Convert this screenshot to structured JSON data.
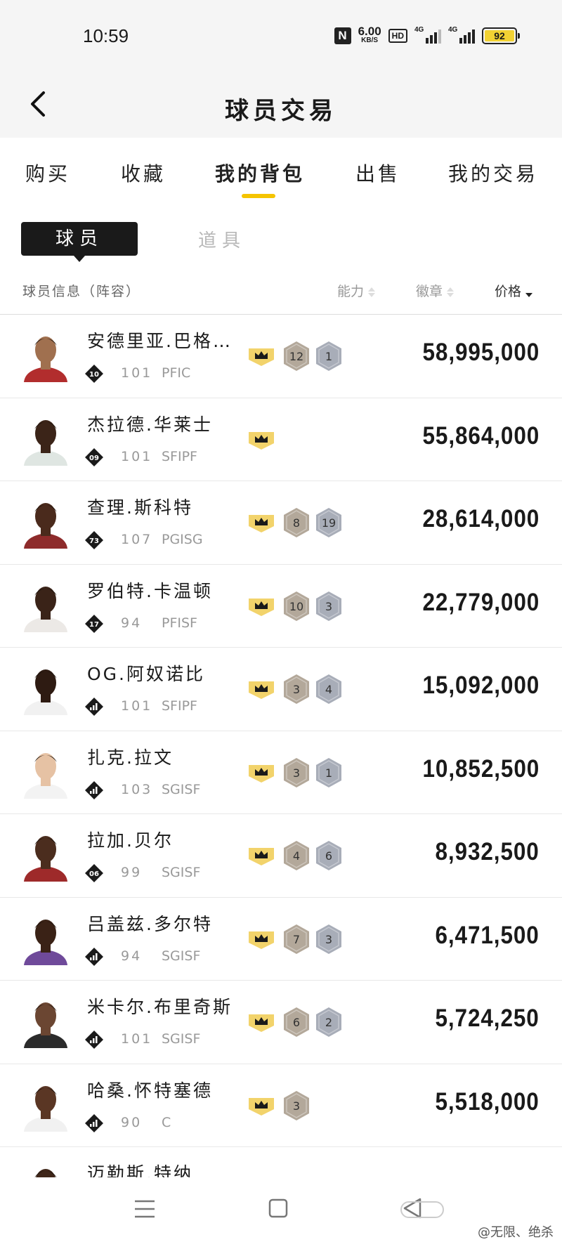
{
  "status_bar": {
    "time": "10:59",
    "nfc": "N",
    "net_speed": "6.00",
    "net_speed_unit": "KB/S",
    "hd": "HD",
    "signal1": "4G",
    "signal2": "4G",
    "battery": "92"
  },
  "header": {
    "title": "球员交易"
  },
  "tabs": [
    {
      "label": "购买"
    },
    {
      "label": "收藏"
    },
    {
      "label": "我的背包",
      "active": true
    },
    {
      "label": "出售"
    },
    {
      "label": "我的交易"
    }
  ],
  "subtabs": {
    "active": "球员",
    "inactive": "道具"
  },
  "columns": {
    "info": "球员信息（阵容）",
    "ability": "能力",
    "badge": "徽章",
    "price": "价格"
  },
  "players": [
    {
      "name": "安德里亚.巴格…",
      "tier": "10",
      "rating": "101",
      "position": "PFIC",
      "badge_a": "12",
      "badge_b": "1",
      "price": "58,995,000"
    },
    {
      "name": "杰拉德.华莱士",
      "tier": "09",
      "rating": "101",
      "position": "SFIPF",
      "badge_a": "",
      "badge_b": "",
      "price": "55,864,000"
    },
    {
      "name": "查理.斯科特",
      "tier": "73",
      "rating": "107",
      "position": "PGISG",
      "badge_a": "8",
      "badge_b": "19",
      "price": "28,614,000"
    },
    {
      "name": "罗伯特.卡温顿",
      "tier": "17",
      "rating": "94",
      "position": "PFISF",
      "badge_a": "10",
      "badge_b": "3",
      "price": "22,779,000"
    },
    {
      "name": "OG.阿奴诺比",
      "tier": "",
      "rating": "101",
      "position": "SFIPF",
      "badge_a": "3",
      "badge_b": "4",
      "price": "15,092,000"
    },
    {
      "name": "扎克.拉文",
      "tier": "",
      "rating": "103",
      "position": "SGISF",
      "badge_a": "3",
      "badge_b": "1",
      "price": "10,852,500"
    },
    {
      "name": "拉加.贝尔",
      "tier": "06",
      "rating": "99",
      "position": "SGISF",
      "badge_a": "4",
      "badge_b": "6",
      "price": "8,932,500"
    },
    {
      "name": "吕盖兹.多尔特",
      "tier": "",
      "rating": "94",
      "position": "SGISF",
      "badge_a": "7",
      "badge_b": "3",
      "price": "6,471,500"
    },
    {
      "name": "米卡尔.布里奇斯",
      "tier": "",
      "rating": "101",
      "position": "SGISF",
      "badge_a": "6",
      "badge_b": "2",
      "price": "5,724,250"
    },
    {
      "name": "哈桑.怀特塞德",
      "tier": "",
      "rating": "90",
      "position": "C",
      "badge_a": "3",
      "badge_b": "",
      "price": "5,518,000"
    },
    {
      "name": "迈勒斯.特纳",
      "tier": "",
      "rating": "",
      "position": "",
      "badge_a": "",
      "badge_b": "",
      "price": ""
    }
  ],
  "watermark": "@无限、绝杀",
  "colors": {
    "accent": "#f5c400",
    "crown": "#f2d36b",
    "badge_gold": "#b3a89a",
    "badge_silver": "#a8adb8"
  }
}
